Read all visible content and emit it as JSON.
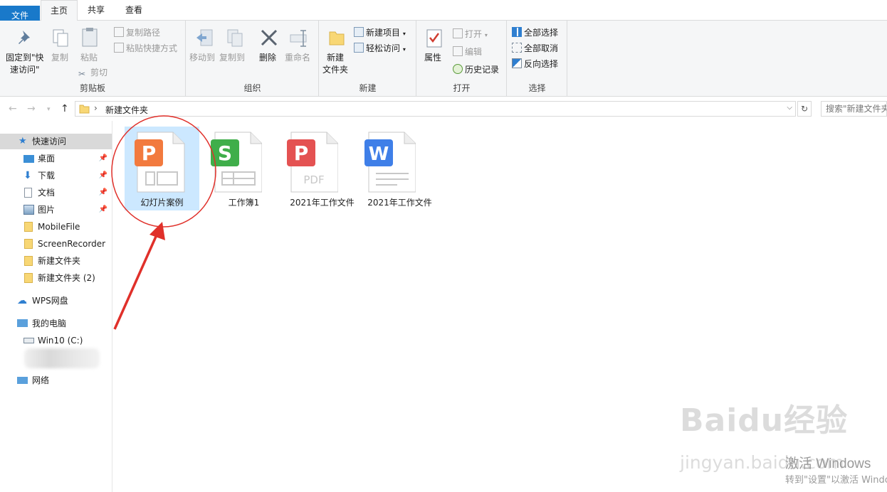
{
  "tabs": {
    "file": "文件",
    "home": "主页",
    "share": "共享",
    "view": "查看"
  },
  "ribbon": {
    "clipboard": {
      "label": "剪贴板",
      "pin": "固定到\"快速访问\"",
      "pin_l1": "固定到\"快",
      "pin_l2": "速访问\"",
      "copy": "复制",
      "paste": "粘贴",
      "copy_path": "复制路径",
      "paste_shortcut": "粘贴快捷方式",
      "cut": "剪切"
    },
    "organize": {
      "label": "组织",
      "move_to": "移动到",
      "copy_to": "复制到",
      "delete": "删除",
      "rename": "重命名"
    },
    "new": {
      "label": "新建",
      "new_folder_l1": "新建",
      "new_folder_l2": "文件夹",
      "new_item": "新建项目",
      "easy_access": "轻松访问"
    },
    "open": {
      "label": "打开",
      "properties": "属性",
      "open": "打开",
      "edit": "编辑",
      "history": "历史记录"
    },
    "select": {
      "label": "选择",
      "select_all": "全部选择",
      "select_none": "全部取消",
      "invert": "反向选择"
    }
  },
  "address": {
    "path": "新建文件夹",
    "search_placeholder": "搜索\"新建文件夹\""
  },
  "sidebar": {
    "quick_access": "快速访问",
    "items": [
      {
        "label": "桌面"
      },
      {
        "label": "下载"
      },
      {
        "label": "文档"
      },
      {
        "label": "图片"
      },
      {
        "label": "MobileFile"
      },
      {
        "label": "ScreenRecorder"
      },
      {
        "label": "新建文件夹"
      },
      {
        "label": "新建文件夹 (2)"
      }
    ],
    "wps": "WPS网盘",
    "pc": "我的电脑",
    "drive": "Win10 (C:)",
    "network": "网络"
  },
  "files": [
    {
      "name": "幻灯片案例",
      "type": "ppt",
      "color": "#f27a3e",
      "letter": "P"
    },
    {
      "name": "工作簿1",
      "type": "xls",
      "color": "#3fae4a",
      "letter": "S"
    },
    {
      "name": "2021年工作文件",
      "type": "pdf",
      "color": "#e45252",
      "letter": "P"
    },
    {
      "name": "2021年工作文件",
      "type": "doc",
      "color": "#3f7fe8",
      "letter": "W"
    }
  ],
  "watermark": {
    "baidu": "Baidu经验",
    "url": "jingyan.baidu.com"
  },
  "activation": {
    "line1": "激活 Windows",
    "line2": "转到\"设置\"以激活 Windows。"
  }
}
